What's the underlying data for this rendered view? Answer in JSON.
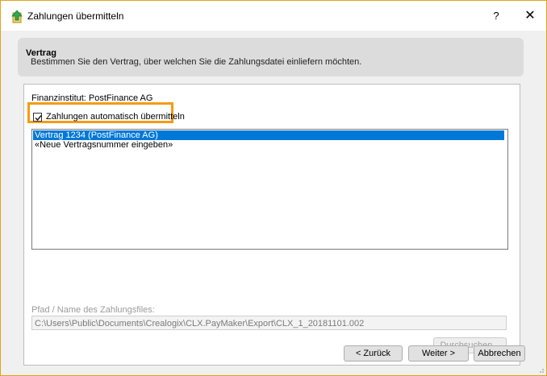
{
  "window": {
    "title": "Zahlungen übermitteln",
    "help_glyph": "?",
    "close_glyph": "✕"
  },
  "header": {
    "title": "Vertrag",
    "subtitle": "Bestimmen Sie den Vertrag, über welchen Sie die Zahlungsdatei einliefern möchten."
  },
  "group": {
    "institution_label": "Finanzinstitut: PostFinance AG",
    "auto_transmit": {
      "label": "Zahlungen automatisch übermitteln",
      "checked": true
    },
    "contracts": [
      {
        "label": "Vertrag 1234 (PostFinance AG)",
        "selected": true
      },
      {
        "label": "«Neue Vertragsnummer eingeben»",
        "selected": false
      }
    ],
    "path_label": "Pfad / Name des Zahlungsfiles:",
    "path_value": "C:\\Users\\Public\\Documents\\Crealogix\\CLX.PayMaker\\Export\\CLX_1_20181101.002",
    "browse_label": "Durchsuchen..."
  },
  "footer": {
    "back_label": "< Zurück",
    "next_label": "Weiter >",
    "cancel_label": "Abbrechen"
  },
  "colors": {
    "highlight": "#f39c12",
    "selection": "#0078d7",
    "window_border": "#e3a21a"
  },
  "icons": {
    "app": "green-up-arrow-document-icon",
    "checkbox": "checkmark-icon",
    "resize": "resize-grip-icon"
  }
}
